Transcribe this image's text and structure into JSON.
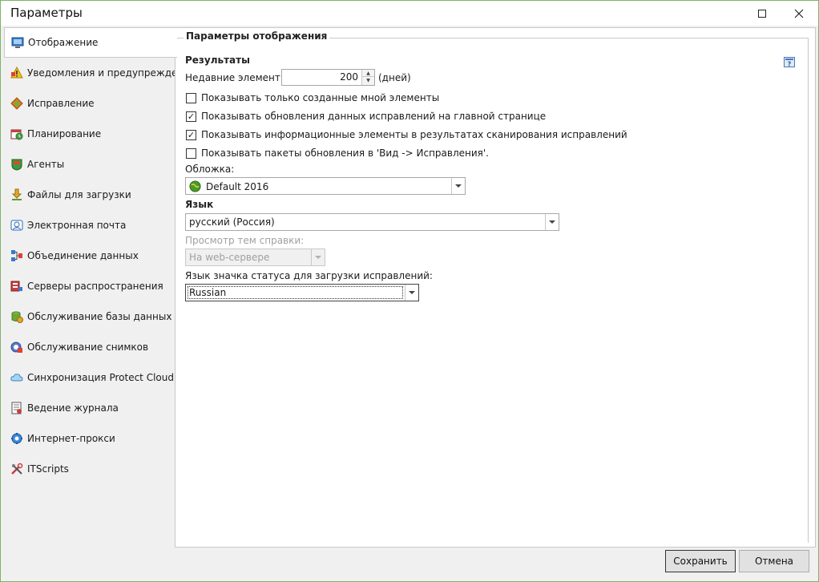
{
  "window": {
    "title": "Параметры"
  },
  "sidebar": {
    "items": [
      {
        "label": "Отображение",
        "icon": "monitor-icon",
        "active": true
      },
      {
        "label": "Уведомления и предупреждения",
        "icon": "warning-icon"
      },
      {
        "label": "Исправление",
        "icon": "patch-icon"
      },
      {
        "label": "Планирование",
        "icon": "calendar-icon"
      },
      {
        "label": "Агенты",
        "icon": "agent-icon"
      },
      {
        "label": "Файлы для загрузки",
        "icon": "download-icon"
      },
      {
        "label": "Электронная почта",
        "icon": "email-icon"
      },
      {
        "label": "Объединение данных",
        "icon": "data-merge-icon"
      },
      {
        "label": "Серверы распространения",
        "icon": "server-icon"
      },
      {
        "label": "Обслуживание базы данных",
        "icon": "database-icon"
      },
      {
        "label": "Обслуживание снимков",
        "icon": "snapshot-icon"
      },
      {
        "label": "Синхронизация Protect Cloud",
        "icon": "cloud-icon"
      },
      {
        "label": "Ведение журнала",
        "icon": "log-icon"
      },
      {
        "label": "Интернет-прокси",
        "icon": "gear-icon"
      },
      {
        "label": "ITScripts",
        "icon": "tools-icon"
      }
    ]
  },
  "panel": {
    "group_title": "Параметры отображения",
    "results_title": "Результаты",
    "recent_label": "Недавние элементы:",
    "recent_value": "200",
    "recent_unit": "(дней)",
    "checkboxes": [
      {
        "label": "Показывать только созданные мной элементы",
        "checked": false
      },
      {
        "label": "Показывать обновления данных исправлений на главной странице",
        "checked": true
      },
      {
        "label": "Показывать информационные элементы в результатах сканирования исправлений",
        "checked": true
      },
      {
        "label": "Показывать пакеты обновления в 'Вид -> Исправления'.",
        "checked": false
      }
    ],
    "skin_label": "Обложка:",
    "skin_value": "Default 2016",
    "language_title": "Язык",
    "language_value": "русский (Россия)",
    "help_view_label": "Просмотр тем справки:",
    "help_view_value": "На web-сервере",
    "status_lang_label": "Язык значка статуса для загрузки исправлений:",
    "status_lang_value": "Russian"
  },
  "buttons": {
    "save": "Сохранить",
    "cancel": "Отмена"
  }
}
